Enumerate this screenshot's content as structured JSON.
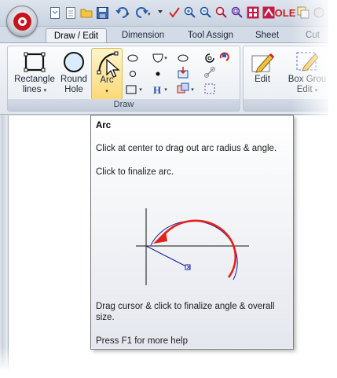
{
  "quick_access": {
    "ole_label": "OLE"
  },
  "tabs": [
    {
      "label": "Draw / Edit",
      "active": true
    },
    {
      "label": "Dimension",
      "active": false
    },
    {
      "label": "Tool Assign",
      "active": false
    },
    {
      "label": "Sheet",
      "active": false
    },
    {
      "label": "Cut",
      "active": false
    }
  ],
  "ribbon": {
    "draw_group": {
      "caption": "Draw",
      "rectangle_label_1": "Rectangle",
      "rectangle_label_2": "lines",
      "round_hole_label_1": "Round",
      "round_hole_label_2": "Hole",
      "arc_label": "Arc"
    },
    "edit_group": {
      "edit_label": "Edit",
      "box_group_label_1": "Box Grou",
      "box_group_label_2": "Edit"
    }
  },
  "tooltip": {
    "title": "Arc",
    "line1": "Click at center to drag out arc radius & angle.",
    "line2": "Click to finalize arc.",
    "line3": "Drag cursor & click to finalize angle & overall size.",
    "help": "Press F1 for more help"
  },
  "colors": {
    "accent_red": "#e2231a",
    "diagram_blue": "#1a1aa6",
    "app_red": "#c8141e"
  }
}
